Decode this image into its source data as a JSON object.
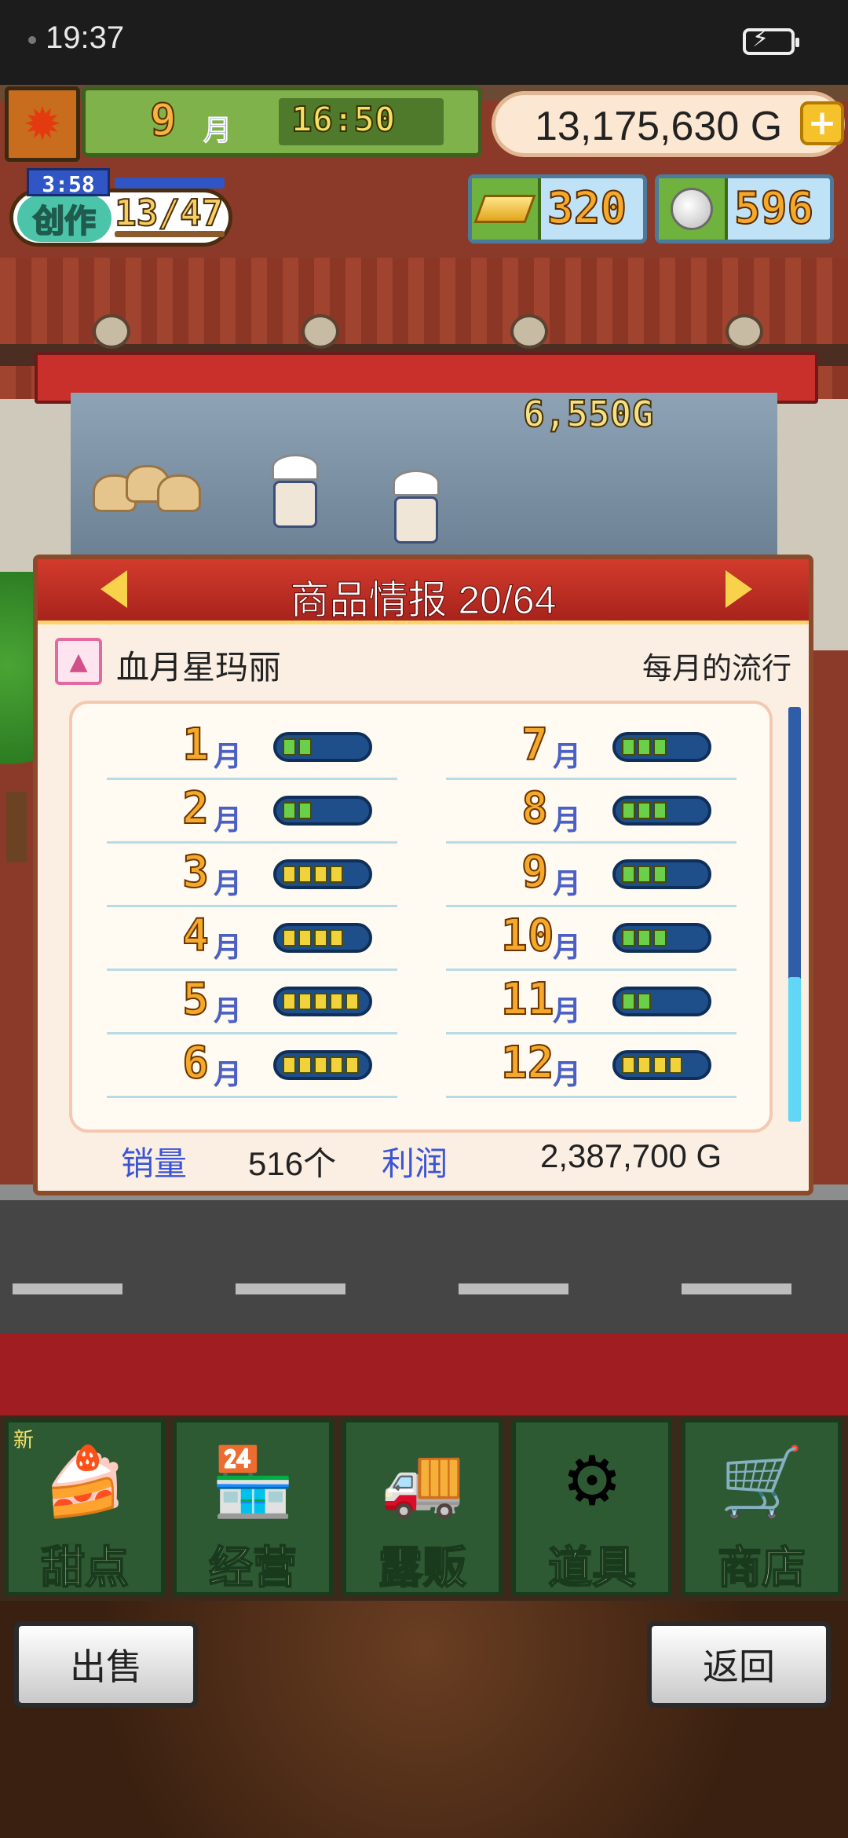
{
  "status_bar": {
    "time": "19:37"
  },
  "hud": {
    "month_number": "9",
    "month_unit": "月",
    "clock": "16:50",
    "money": "13,175,630 G",
    "create_label": "创作",
    "create_timer": "3:58",
    "create_count": "13/47",
    "gold_bars": "320",
    "silver_coins": "596"
  },
  "scene": {
    "floating_price": "6,550G"
  },
  "panel": {
    "title": "商品情报 20/64",
    "product_name": "血月星玛丽",
    "trend_label": "每月的流行",
    "months": [
      {
        "num": "1",
        "unit": "月",
        "level": 2,
        "max": 5
      },
      {
        "num": "2",
        "unit": "月",
        "level": 2,
        "max": 5
      },
      {
        "num": "3",
        "unit": "月",
        "level": 4,
        "max": 5
      },
      {
        "num": "4",
        "unit": "月",
        "level": 4,
        "max": 5
      },
      {
        "num": "5",
        "unit": "月",
        "level": 5,
        "max": 5
      },
      {
        "num": "6",
        "unit": "月",
        "level": 5,
        "max": 5
      },
      {
        "num": "7",
        "unit": "月",
        "level": 3,
        "max": 5
      },
      {
        "num": "8",
        "unit": "月",
        "level": 3,
        "max": 5
      },
      {
        "num": "9",
        "unit": "月",
        "level": 3,
        "max": 5
      },
      {
        "num": "10",
        "unit": "月",
        "level": 3,
        "max": 5
      },
      {
        "num": "11",
        "unit": "月",
        "level": 2,
        "max": 5
      },
      {
        "num": "12",
        "unit": "月",
        "level": 4,
        "max": 5
      }
    ],
    "sales_label": "销量",
    "sales_value": "516个",
    "profit_label": "利润",
    "profit_value": "2,387,700 G"
  },
  "nav": {
    "items": [
      {
        "label": "甜点",
        "badge": "新",
        "icon": "cake-icon"
      },
      {
        "label": "经营",
        "icon": "shop-building-icon"
      },
      {
        "label": "露贩",
        "icon": "food-truck-icon"
      },
      {
        "label": "道具",
        "icon": "gear-bag-icon"
      },
      {
        "label": "商店",
        "icon": "shopping-cart-icon"
      }
    ]
  },
  "buttons": {
    "sell": "出售",
    "back": "返回"
  },
  "colors": {
    "panel_header": "#c0302a",
    "bar_fill_yellow": "#f2d23a",
    "bar_fill_green": "#6ad04a",
    "bar_bg": "#1f4f8a"
  }
}
